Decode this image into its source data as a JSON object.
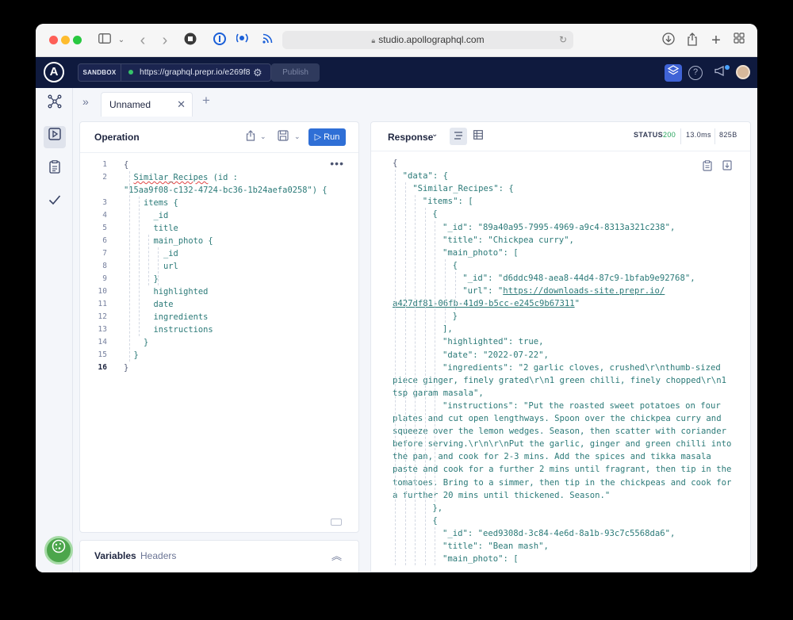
{
  "browser": {
    "url": "studio.apollographql.com"
  },
  "header": {
    "logo": "A",
    "mode_label": "SANDBOX",
    "endpoint_url": "https://graphql.prepr.io/e269f8",
    "publish_label": "Publish"
  },
  "tabs": [
    {
      "label": "Unnamed"
    }
  ],
  "operation": {
    "title": "Operation",
    "run_label": "▷ Run",
    "lines": [
      {
        "n": "1",
        "text": "{",
        "brace": true
      },
      {
        "n": "2",
        "text": "  Similar_Recipes (id :",
        "squiggle": "Similar_Recipes"
      },
      {
        "n": "",
        "text": "\"15aa9f08-c132-4724-bc36-1b24aefa0258\") {",
        "wrap": true
      },
      {
        "n": "3",
        "text": "    items {"
      },
      {
        "n": "4",
        "text": "      _id"
      },
      {
        "n": "5",
        "text": "      title"
      },
      {
        "n": "6",
        "text": "      main_photo {"
      },
      {
        "n": "7",
        "text": "        _id"
      },
      {
        "n": "8",
        "text": "        url"
      },
      {
        "n": "9",
        "text": "      }"
      },
      {
        "n": "10",
        "text": "      highlighted"
      },
      {
        "n": "11",
        "text": "      date"
      },
      {
        "n": "12",
        "text": "      ingredients"
      },
      {
        "n": "13",
        "text": "      instructions"
      },
      {
        "n": "14",
        "text": "    }"
      },
      {
        "n": "15",
        "text": "  }"
      },
      {
        "n": "16",
        "text": "}",
        "brace": true,
        "current": true
      }
    ]
  },
  "variables": {
    "tab_variables": "Variables",
    "tab_headers": "Headers"
  },
  "response": {
    "title": "Response",
    "status_label": "STATUS",
    "status_code": "200",
    "time": "13.0ms",
    "size": "825B",
    "lines": [
      {
        "i": 0,
        "text": "{"
      },
      {
        "i": 1,
        "text": "\"data\": {"
      },
      {
        "i": 2,
        "text": "\"Similar_Recipes\": {"
      },
      {
        "i": 3,
        "text": "\"items\": ["
      },
      {
        "i": 4,
        "text": "{"
      },
      {
        "i": 5,
        "text": "\"_id\": \"89a40a95-7995-4969-a9c4-8313a321c238\","
      },
      {
        "i": 5,
        "text": "\"title\": \"Chickpea curry\","
      },
      {
        "i": 5,
        "text": "\"main_photo\": ["
      },
      {
        "i": 6,
        "text": "{"
      },
      {
        "i": 7,
        "text": "\"_id\": \"d6ddc948-aea8-44d4-87c9-1bfab9e92768\","
      },
      {
        "i": 7,
        "text": "\"url\": \"",
        "link": "https://downloads-site.prepr.io/"
      },
      {
        "i": -1,
        "text": "",
        "link": "a427df81-06fb-41d9-b5cc-e245c9b67311",
        "after": "\""
      },
      {
        "i": 6,
        "text": "}"
      },
      {
        "i": 5,
        "text": "],"
      },
      {
        "i": 5,
        "text": "\"highlighted\": true,"
      },
      {
        "i": 5,
        "text": "\"date\": \"2022-07-22\","
      },
      {
        "i": 5,
        "text": "\"ingredients\": \"2 garlic cloves, crushed\\r\\nthumb-sized"
      },
      {
        "i": -1,
        "text": "piece ginger, finely grated\\r\\n1 green chilli, finely chopped\\r\\n1"
      },
      {
        "i": -1,
        "text": "tsp garam masala\","
      },
      {
        "i": 5,
        "text": "\"instructions\": \"Put the roasted sweet potatoes on four"
      },
      {
        "i": -1,
        "text": "plates and cut open lengthways. Spoon over the chickpea curry and"
      },
      {
        "i": -1,
        "text": "squeeze over the lemon wedges. Season, then scatter with coriander"
      },
      {
        "i": -1,
        "text": "before serving.\\r\\n\\r\\nPut the garlic, ginger and green chilli into"
      },
      {
        "i": -1,
        "text": "the pan, and cook for 2-3 mins. Add the spices and tikka masala"
      },
      {
        "i": -1,
        "text": "paste and cook for a further 2 mins until fragrant, then tip in the"
      },
      {
        "i": -1,
        "text": "tomatoes. Bring to a simmer, then tip in the chickpeas and cook for"
      },
      {
        "i": -1,
        "text": "a further 20 mins until thickened. Season.\""
      },
      {
        "i": 4,
        "text": "},"
      },
      {
        "i": 4,
        "text": "{"
      },
      {
        "i": 5,
        "text": "\"_id\": \"eed9308d-3c84-4e6d-8a1b-93c7c5568da6\","
      },
      {
        "i": 5,
        "text": "\"title\": \"Bean mash\","
      },
      {
        "i": 5,
        "text": "\"main_photo\": ["
      }
    ]
  },
  "colors": {
    "header_bg": "#0f1a3e",
    "run_button": "#2f6fd6",
    "status_ok": "#26a35c",
    "code_text": "#2b7a78"
  },
  "icons": [
    "sidebar-icon",
    "back-icon",
    "forward-icon",
    "stop-icon",
    "download-icon",
    "share-icon",
    "new-tab-icon",
    "tab-overview-icon",
    "schema-icon",
    "explorer-play-icon",
    "checklist-icon",
    "checkmark-icon",
    "cookie-icon"
  ]
}
